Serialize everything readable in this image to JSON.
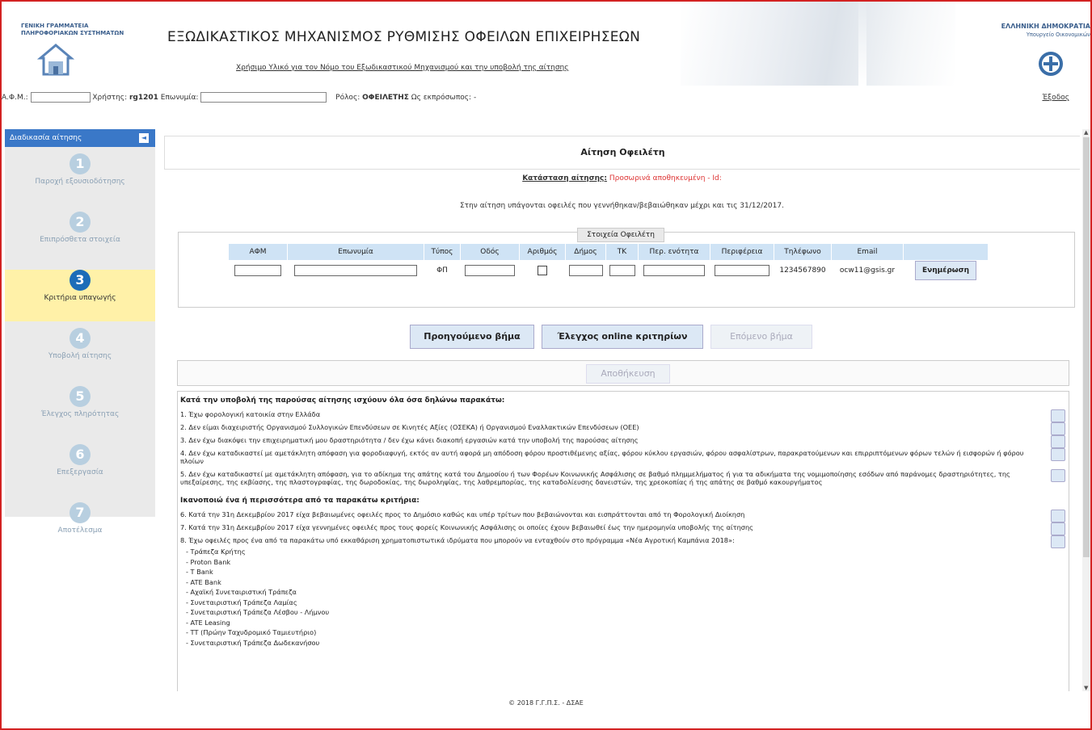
{
  "header": {
    "gsis_line1": "ΓΕΝΙΚΗ ΓΡΑΜΜΑΤΕΙΑ",
    "gsis_line2": "ΠΛΗΡΟΦΟΡΙΑΚΩΝ ΣΥΣΤΗΜΑΤΩΝ",
    "title": "ΕΞΩΔΙΚΑΣΤΙΚΟΣ ΜΗΧΑΝΙΣΜΟΣ ΡΥΘΜΙΣΗΣ ΟΦΕΙΛΩΝ ΕΠΙΧΕΙΡΗΣΕΩΝ",
    "help_link": "Χρήσιμο Υλικό για τον Νόμο του Εξωδικαστικού Μηχανισμού και την υποβολή της αίτησης",
    "gov_line1": "ΕΛΛΗΝΙΚΗ ΔΗΜΟΚΡΑΤΙΑ",
    "gov_line2": "Υπουργείο Οικονομικών"
  },
  "userbar": {
    "afm_label": "Α.Φ.Μ.:",
    "user_label": "Χρήστης:",
    "user_value": "rg1201",
    "name_label": "Επωνυμία:",
    "role_label": "Ρόλος:",
    "role_value": "ΟΦΕΙΛΕΤΗΣ",
    "rep_label": "Ως εκπρόσωπος:",
    "rep_value": "-",
    "logout": "Έξοδος"
  },
  "sidebar": {
    "title": "Διαδικασία αίτησης",
    "collapse": "◄",
    "steps": [
      {
        "num": "1",
        "label": "Παροχή εξουσιοδότησης"
      },
      {
        "num": "2",
        "label": "Επιπρόσθετα στοιχεία"
      },
      {
        "num": "3",
        "label": "Κριτήρια υπαγωγής"
      },
      {
        "num": "4",
        "label": "Υποβολή αίτησης"
      },
      {
        "num": "5",
        "label": "Έλεγχος πληρότητας"
      },
      {
        "num": "6",
        "label": "Επεξεργασία"
      },
      {
        "num": "7",
        "label": "Αποτέλεσμα"
      }
    ]
  },
  "main": {
    "title": "Αίτηση Οφειλέτη",
    "status_label": "Κατάσταση αίτησης:",
    "status_value": "Προσωρινά αποθηκευμένη - Id:",
    "period_text": "Στην αίτηση υπάγονται οφειλές που γεννήθηκαν/βεβαιώθηκαν μέχρι και τις 31/12/2017.",
    "debtor_legend": "Στοιχεία Οφειλέτη",
    "table_headers": [
      "ΑΦΜ",
      "Επωνυμία",
      "Τύπος",
      "Οδός",
      "Αριθμός",
      "Δήμος",
      "ΤΚ",
      "Περ. ενότητα",
      "Περιφέρεια",
      "Τηλέφωνο",
      "Email",
      ""
    ],
    "row": {
      "type": "ΦΠ",
      "phone": "1234567890",
      "email": "ocw11@gsis.gr",
      "update": "Ενημέρωση"
    },
    "buttons": {
      "prev": "Προηγούμενο βήμα",
      "check": "Έλεγχος online κριτηρίων",
      "next": "Επόμενο βήμα",
      "save": "Αποθήκευση"
    },
    "decl_header1": "Κατά την υποβολή της παρούσας αίτησης ισχύουν όλα όσα δηλώνω παρακάτω:",
    "decl_items1": [
      "1. Έχω φορολογική κατοικία στην Ελλάδα",
      "2. Δεν είμαι διαχειριστής Οργανισμού Συλλογικών Επενδύσεων σε Κινητές Αξίες (ΟΣΕΚΑ) ή Οργανισμού Εναλλακτικών Επενδύσεων (ΟΕΕ)",
      "3. Δεν έχω διακόψει την επιχειρηματική μου δραστηριότητα / δεν έχω κάνει διακοπή εργασιών κατά την υποβολή της παρούσας αίτησης",
      "4. Δεν έχω καταδικαστεί με αμετάκλητη απόφαση για φοροδιαφυγή, εκτός αν αυτή αφορά μη απόδοση φόρου προστιθέμενης αξίας, φόρου κύκλου εργασιών, φόρου ασφαλίστρων, παρακρατούμενων και επιρριπτόμενων φόρων τελών ή εισφορών ή φόρου πλοίων",
      "5. Δεν έχω καταδικαστεί με αμετάκλητη απόφαση, για το αδίκημα της απάτης κατά του Δημοσίου ή των Φορέων Κοινωνικής Ασφάλισης σε βαθμό πλημμελήματος ή για τα αδικήματα της νομιμοποίησης εσόδων από παράνομες δραστηριότητες, της υπεξαίρεσης, της εκβίασης, της πλαστογραφίας, της δωροδοκίας, της δωροληψίας, της λαθρεμπορίας, της καταδολίευσης δανειστών, της χρεοκοπίας ή της απάτης σε βαθμό κακουργήματος"
    ],
    "decl_header2": "Ικανοποιώ ένα ή περισσότερα από τα παρακάτω κριτήρια:",
    "decl_items2": [
      "6. Κατά την 31η Δεκεμβρίου 2017 είχα βεβαιωμένες οφειλές προς το Δημόσιο καθώς και υπέρ τρίτων που βεβαιώνονται και εισπράττονται από τη Φορολογική Διοίκηση",
      "7. Κατά την 31η Δεκεμβρίου 2017 είχα γεννημένες οφειλές προς τους φορείς Κοινωνικής Ασφάλισης οι οποίες έχουν βεβαιωθεί έως την ημερομηνία υποβολής της αίτησης",
      "8. Έχω οφειλές προς ένα από τα παρακάτω υπό εκκαθάριση χρηματοπιστωτικά ιδρύματα που μπορούν να ενταχθούν στο πρόγραμμα «Νέα Αγροτική Καμπάνια 2018»:"
    ],
    "banks": [
      "- Τράπεζα Κρήτης",
      "- Proton Bank",
      "- T Bank",
      "- ATE Bank",
      "- Αχαϊκή Συνεταιριστική Τράπεζα",
      "- Συνεταιριστική Τράπεζα Λαμίας",
      "- Συνεταιριστική Τράπεζα Λέσβου - Λήμνου",
      "- ATE Leasing",
      "- ΤΤ (Πρώην Ταχυδρομικό Ταμιευτήριο)",
      "- Συνεταιριστική Τράπεζα Δωδεκανήσου"
    ]
  },
  "footer": "© 2018 Γ.Γ.Π.Σ. - ΔΣΑΕ",
  "colors": {
    "accent": "#3a78c8",
    "active_step": "#fff1a8",
    "frame": "#d32222",
    "status_red": "#dd3333"
  }
}
